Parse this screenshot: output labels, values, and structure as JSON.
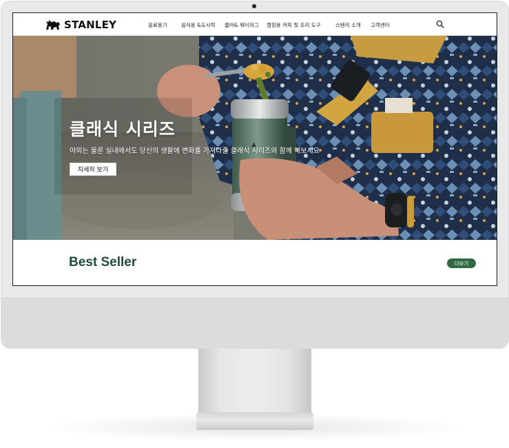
{
  "brand": {
    "name": "STANLEY"
  },
  "nav": {
    "items": [
      {
        "label": "음료용기"
      },
      {
        "label": "음식용 &도시락"
      },
      {
        "label": "쿨러& 워터저그"
      },
      {
        "label": "캠핑용 커피 및 조리 도구"
      },
      {
        "label": "스탠리 소개"
      },
      {
        "label": "고객센터"
      }
    ],
    "search_icon": "search-icon"
  },
  "hero": {
    "title": "클래식 시리즈",
    "subtitle": "야외는 물론 실내에서도 당신의 생활에 변화를 가져다줄 클래식 시리즈와 함께 해보세요",
    "button_label": "자세히 보기"
  },
  "best_seller": {
    "title": "Best Seller",
    "more_label": "더보기"
  },
  "colors": {
    "brand_green": "#1f4b3b",
    "button_green": "#2e6b43"
  }
}
